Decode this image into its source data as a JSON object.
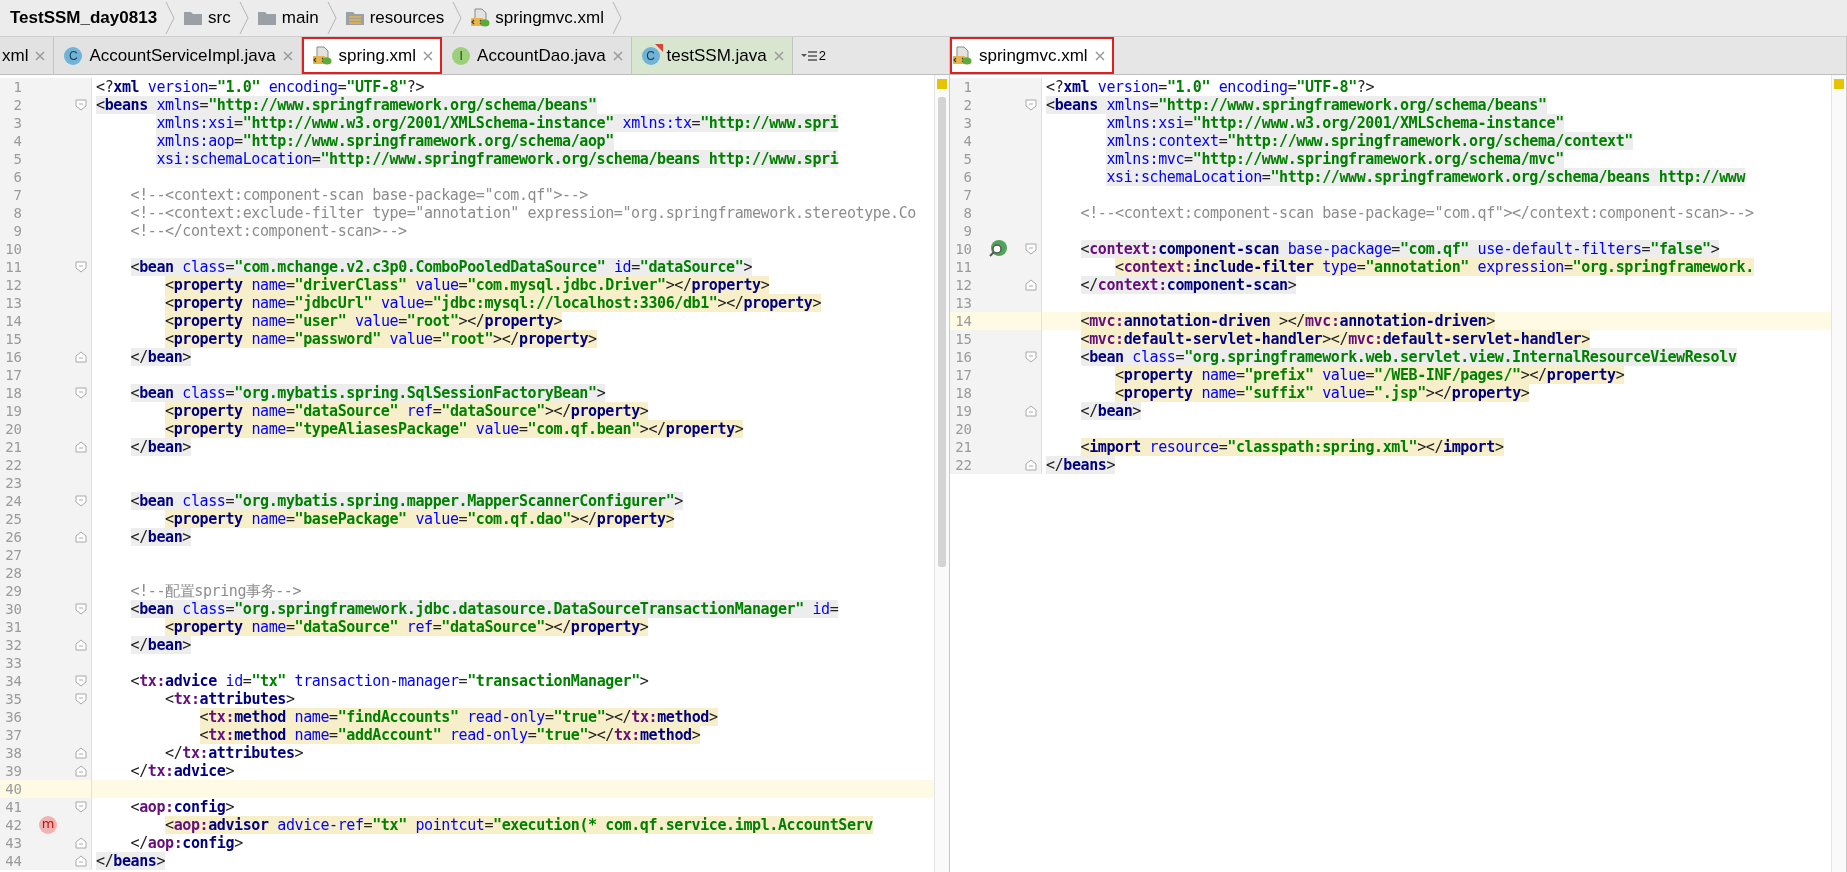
{
  "breadcrumb": [
    {
      "label": "TestSSM_day0813",
      "kind": "project"
    },
    {
      "label": "src",
      "kind": "folder"
    },
    {
      "label": "main",
      "kind": "folder"
    },
    {
      "label": "resources",
      "kind": "resources"
    },
    {
      "label": "springmvc.xml",
      "kind": "xml"
    }
  ],
  "left_editor": {
    "tabs": [
      {
        "label": "xml",
        "kind": "none",
        "selected": false,
        "annotated": false
      },
      {
        "label": "AccountServiceImpl.java",
        "kind": "class",
        "icon_letter": "C",
        "selected": false,
        "annotated": false
      },
      {
        "label": "spring.xml",
        "kind": "xml",
        "selected": true,
        "annotated": true
      },
      {
        "label": "AccountDao.java",
        "kind": "interface",
        "icon_letter": "I",
        "selected": false,
        "annotated": false
      },
      {
        "label": "testSSM.java",
        "kind": "runnable",
        "icon_letter": "C",
        "selected": false,
        "annotated": false,
        "color": "#d9e6cf"
      }
    ],
    "overflow_count": "2",
    "lines": [
      {
        "n": "1",
        "text": "<?xml version=\"1.0\" encoding=\"UTF-8\"?>"
      },
      {
        "n": "2",
        "text": "<beans xmlns=\"http://www.springframework.org/schema/beans\"",
        "kind": "tag",
        "fold_start": true
      },
      {
        "n": "3",
        "text": "       xmlns:xsi=\"http://www.w3.org/2001/XMLSchema-instance\" xmlns:tx=\"http://www.spri",
        "kind": "tag"
      },
      {
        "n": "4",
        "text": "       xmlns:aop=\"http://www.springframework.org/schema/aop\"",
        "kind": "tag"
      },
      {
        "n": "5",
        "text": "       xsi:schemaLocation=\"http://www.springframework.org/schema/beans http://www.spri",
        "kind": "tag"
      },
      {
        "n": "6"
      },
      {
        "n": "7",
        "text": "    <!--<context:component-scan base-package=\"com.qf\">-->"
      },
      {
        "n": "8",
        "text": "    <!--<context:exclude-filter type=\"annotation\" expression=\"org.springframework.stereotype.Co"
      },
      {
        "n": "9",
        "text": "    <!--</context:component-scan>-->"
      },
      {
        "n": "10"
      },
      {
        "n": "11",
        "text": "    <bean class=\"com.mchange.v2.c3p0.ComboPooledDataSource\" id=\"dataSource\">",
        "kind": "tag",
        "fold_start": true
      },
      {
        "n": "12",
        "text": "        <property name=\"driverClass\" value=\"com.mysql.jdbc.Driver\"></property>",
        "kind": "body"
      },
      {
        "n": "13",
        "text": "        <property name=\"jdbcUrl\" value=\"jdbc:mysql://localhost:3306/db1\"></property>",
        "kind": "body"
      },
      {
        "n": "14",
        "text": "        <property name=\"user\" value=\"root\"></property>",
        "kind": "body"
      },
      {
        "n": "15",
        "text": "        <property name=\"password\" value=\"root\"></property>",
        "kind": "body"
      },
      {
        "n": "16",
        "text": "    </bean>",
        "kind": "tag",
        "fold_end": true
      },
      {
        "n": "17"
      },
      {
        "n": "18",
        "text": "    <bean class=\"org.mybatis.spring.SqlSessionFactoryBean\">",
        "kind": "tag",
        "fold_start": true
      },
      {
        "n": "19",
        "text": "        <property name=\"dataSource\" ref=\"dataSource\"></property>",
        "kind": "body"
      },
      {
        "n": "20",
        "text": "        <property name=\"typeAliasesPackage\" value=\"com.qf.bean\"></property>",
        "kind": "body"
      },
      {
        "n": "21",
        "text": "    </bean>",
        "kind": "tag",
        "fold_end": true
      },
      {
        "n": "22"
      },
      {
        "n": "23"
      },
      {
        "n": "24",
        "text": "    <bean class=\"org.mybatis.spring.mapper.MapperScannerConfigurer\">",
        "kind": "tag",
        "fold_start": true
      },
      {
        "n": "25",
        "text": "        <property name=\"basePackage\" value=\"com.qf.dao\"></property>",
        "kind": "body"
      },
      {
        "n": "26",
        "text": "    </bean>",
        "kind": "tag",
        "fold_end": true
      },
      {
        "n": "27"
      },
      {
        "n": "28"
      },
      {
        "n": "29",
        "text": "    <!--配置spring事务-->"
      },
      {
        "n": "30",
        "text": "    <bean class=\"org.springframework.jdbc.datasource.DataSourceTransactionManager\" id=",
        "kind": "tag",
        "fold_start": true
      },
      {
        "n": "31",
        "text": "        <property name=\"dataSource\" ref=\"dataSource\"></property>",
        "kind": "body"
      },
      {
        "n": "32",
        "text": "    </bean>",
        "kind": "tag",
        "fold_end": true
      },
      {
        "n": "33"
      },
      {
        "n": "34",
        "text": "    <tx:advice id=\"tx\" transaction-manager=\"transactionManager\">",
        "fold_start": true
      },
      {
        "n": "35",
        "text": "        <tx:attributes>",
        "fold_start": true
      },
      {
        "n": "36",
        "text": "            <tx:method name=\"findAccounts\" read-only=\"true\"></tx:method>",
        "kind": "body"
      },
      {
        "n": "37",
        "text": "            <tx:method name=\"addAccount\" read-only=\"true\"></tx:method>",
        "kind": "body"
      },
      {
        "n": "38",
        "text": "        </tx:attributes>",
        "fold_end": true
      },
      {
        "n": "39",
        "text": "    </tx:advice>",
        "fold_end": true
      },
      {
        "n": "40",
        "current": true
      },
      {
        "n": "41",
        "text": "    <aop:config>",
        "fold_start": true
      },
      {
        "n": "42",
        "text": "        <aop:advisor advice-ref=\"tx\" pointcut=\"execution(* com.qf.service.impl.AccountServ",
        "kind": "body",
        "marker": {
          "kind": "method",
          "label": "m"
        }
      },
      {
        "n": "43",
        "text": "    </aop:config>",
        "fold_end": true
      },
      {
        "n": "44",
        "text": "</beans>",
        "kind": "tag",
        "fold_end": true
      }
    ]
  },
  "right_editor": {
    "tabs": [
      {
        "label": "springmvc.xml",
        "kind": "xml",
        "selected": true,
        "annotated": true
      }
    ],
    "lines": [
      {
        "n": "1",
        "text": "<?xml version=\"1.0\" encoding=\"UTF-8\"?>"
      },
      {
        "n": "2",
        "text": "<beans xmlns=\"http://www.springframework.org/schema/beans\"",
        "kind": "tag",
        "fold_start": true
      },
      {
        "n": "3",
        "text": "       xmlns:xsi=\"http://www.w3.org/2001/XMLSchema-instance\"",
        "kind": "tag"
      },
      {
        "n": "4",
        "text": "       xmlns:context=\"http://www.springframework.org/schema/context\"",
        "kind": "tag"
      },
      {
        "n": "5",
        "text": "       xmlns:mvc=\"http://www.springframework.org/schema/mvc\"",
        "kind": "tag"
      },
      {
        "n": "6",
        "text": "       xsi:schemaLocation=\"http://www.springframework.org/schema/beans http://www",
        "kind": "tag"
      },
      {
        "n": "7"
      },
      {
        "n": "8",
        "text": "    <!--<context:component-scan base-package=\"com.qf\"></context:component-scan>-->"
      },
      {
        "n": "9"
      },
      {
        "n": "10",
        "text": "    <context:component-scan base-package=\"com.qf\" use-default-filters=\"false\">",
        "kind": "tag",
        "fold_start": true,
        "marker": {
          "kind": "search"
        }
      },
      {
        "n": "11",
        "text": "        <context:include-filter type=\"annotation\" expression=\"org.springframework.",
        "kind": "body"
      },
      {
        "n": "12",
        "text": "    </context:component-scan>",
        "kind": "tag",
        "fold_end": true
      },
      {
        "n": "13"
      },
      {
        "n": "14",
        "text": "    <mvc:annotation-driven ></mvc:annotation-driven>",
        "kind": "body",
        "current": true
      },
      {
        "n": "15",
        "text": "    <mvc:default-servlet-handler></mvc:default-servlet-handler>",
        "kind": "body"
      },
      {
        "n": "16",
        "text": "    <bean class=\"org.springframework.web.servlet.view.InternalResourceViewResolv",
        "kind": "tag",
        "fold_start": true
      },
      {
        "n": "17",
        "text": "        <property name=\"prefix\" value=\"/WEB-INF/pages/\"></property>",
        "kind": "body"
      },
      {
        "n": "18",
        "text": "        <property name=\"suffix\" value=\".jsp\"></property>",
        "kind": "body"
      },
      {
        "n": "19",
        "text": "    </bean>",
        "kind": "tag",
        "fold_end": true
      },
      {
        "n": "20"
      },
      {
        "n": "21",
        "text": "    <import resource=\"classpath:spring.xml\"></import>",
        "kind": "body"
      },
      {
        "n": "22",
        "text": "</beans>",
        "kind": "tag",
        "fold_end": true
      }
    ]
  }
}
